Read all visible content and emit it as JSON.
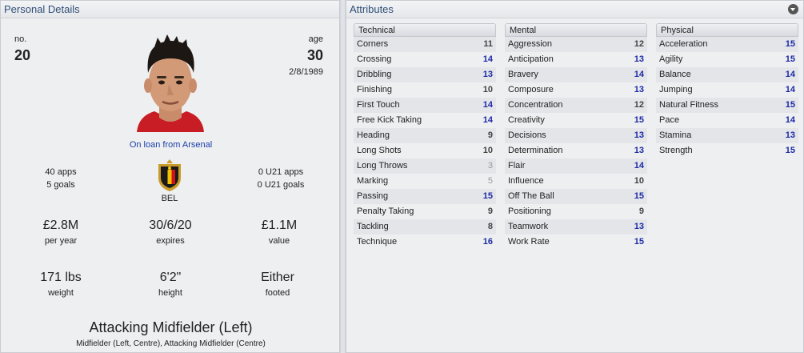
{
  "personal": {
    "header": "Personal Details",
    "no_label": "no.",
    "no_value": "20",
    "age_label": "age",
    "age_value": "30",
    "dob": "2/8/1989",
    "loan_text": "On loan from Arsenal",
    "apps": "40 apps",
    "goals": "5 goals",
    "nation": "BEL",
    "u21_apps": "0 U21 apps",
    "u21_goals": "0 U21 goals",
    "wage_value": "£2.8M",
    "wage_label": "per year",
    "expires_value": "30/6/20",
    "expires_label": "expires",
    "value_value": "£1.1M",
    "value_label": "value",
    "weight_value": "171 lbs",
    "weight_label": "weight",
    "height_value": "6'2\"",
    "height_label": "height",
    "foot_value": "Either",
    "foot_label": "footed",
    "position_main": "Attacking Midfielder (Left)",
    "position_sub": "Midfielder (Left, Centre), Attacking Midfielder (Centre)",
    "crest_colors": {
      "black": "#1a1a1a",
      "yellow": "#f2c200",
      "red": "#d0121b",
      "gold": "#c89b2a"
    }
  },
  "attributes": {
    "header": "Attributes",
    "columns": [
      {
        "title": "Technical",
        "rows": [
          {
            "name": "Corners",
            "value": "11"
          },
          {
            "name": "Crossing",
            "value": "14"
          },
          {
            "name": "Dribbling",
            "value": "13"
          },
          {
            "name": "Finishing",
            "value": "10"
          },
          {
            "name": "First Touch",
            "value": "14"
          },
          {
            "name": "Free Kick Taking",
            "value": "14"
          },
          {
            "name": "Heading",
            "value": "9"
          },
          {
            "name": "Long Shots",
            "value": "10"
          },
          {
            "name": "Long Throws",
            "value": "3"
          },
          {
            "name": "Marking",
            "value": "5"
          },
          {
            "name": "Passing",
            "value": "15"
          },
          {
            "name": "Penalty Taking",
            "value": "9"
          },
          {
            "name": "Tackling",
            "value": "8"
          },
          {
            "name": "Technique",
            "value": "16"
          }
        ]
      },
      {
        "title": "Mental",
        "rows": [
          {
            "name": "Aggression",
            "value": "12"
          },
          {
            "name": "Anticipation",
            "value": "13"
          },
          {
            "name": "Bravery",
            "value": "14"
          },
          {
            "name": "Composure",
            "value": "13"
          },
          {
            "name": "Concentration",
            "value": "12"
          },
          {
            "name": "Creativity",
            "value": "15"
          },
          {
            "name": "Decisions",
            "value": "13"
          },
          {
            "name": "Determination",
            "value": "13"
          },
          {
            "name": "Flair",
            "value": "14"
          },
          {
            "name": "Influence",
            "value": "10"
          },
          {
            "name": "Off The Ball",
            "value": "15"
          },
          {
            "name": "Positioning",
            "value": "9"
          },
          {
            "name": "Teamwork",
            "value": "13"
          },
          {
            "name": "Work Rate",
            "value": "15"
          }
        ]
      },
      {
        "title": "Physical",
        "rows": [
          {
            "name": "Acceleration",
            "value": "15"
          },
          {
            "name": "Agility",
            "value": "15"
          },
          {
            "name": "Balance",
            "value": "14"
          },
          {
            "name": "Jumping",
            "value": "14"
          },
          {
            "name": "Natural Fitness",
            "value": "15"
          },
          {
            "name": "Pace",
            "value": "14"
          },
          {
            "name": "Stamina",
            "value": "13"
          },
          {
            "name": "Strength",
            "value": "15"
          }
        ]
      }
    ],
    "colors": {
      "high": "#1c2aa6",
      "mid": "#444444",
      "low": "#999999"
    }
  }
}
